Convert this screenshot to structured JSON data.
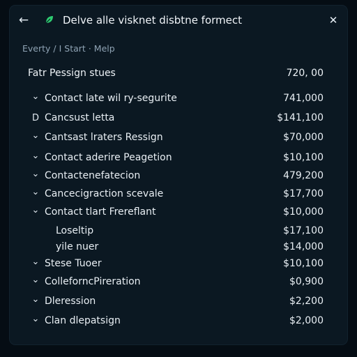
{
  "window": {
    "title": "Delve alle visknet disbtne formect",
    "back_icon": "arrow-left-icon",
    "close_icon": "close-icon",
    "app_icon": "leaf-icon"
  },
  "breadcrumb": [
    "Everty",
    "I Start",
    "Melp"
  ],
  "breadcrumb_sep": "/",
  "header": {
    "label": "Fatr Pessign stues",
    "amount": "720, 00"
  },
  "rows": [
    {
      "marker": "chevron",
      "label": "Contact late wil ry-segurite",
      "amount": "741,000"
    },
    {
      "marker": "D",
      "label": "Cancsust letta",
      "amount": "$141,100"
    },
    {
      "marker": "chevron",
      "label": "Cantsast lraters Ressign",
      "amount": "$70,000"
    },
    {
      "marker": "chevron",
      "label": "Contact aderire Peagetion",
      "amount": "$10,100"
    },
    {
      "marker": "chevron",
      "label": "Contactenefatecion",
      "amount": "479,200"
    },
    {
      "marker": "chevron",
      "label": "Cancecigraction scevale",
      "amount": "$17,700"
    },
    {
      "marker": "chevron",
      "label": "Contact tlart Frereflant",
      "amount": "$10,000"
    },
    {
      "marker": "",
      "label": "Loseltip",
      "amount": "$17,100",
      "sub": true
    },
    {
      "marker": "",
      "label": "yile nuer",
      "amount": "$14,000",
      "sub": true
    },
    {
      "marker": "chevron",
      "label": "Stese Tuoer",
      "amount": "$10,100"
    },
    {
      "marker": "chevron",
      "label": "ColleforncPireration",
      "amount": "$0,900"
    },
    {
      "marker": "chevron",
      "label": "Dleression",
      "amount": "$2,200"
    },
    {
      "marker": "chevron",
      "label": "Clan dlepatsign",
      "amount": "$2,000"
    }
  ],
  "colors": {
    "background": "#050d14",
    "panel": "#0b1822",
    "text": "#e9eff4",
    "muted": "#8fa3b4",
    "accent": "#2ecc71"
  }
}
